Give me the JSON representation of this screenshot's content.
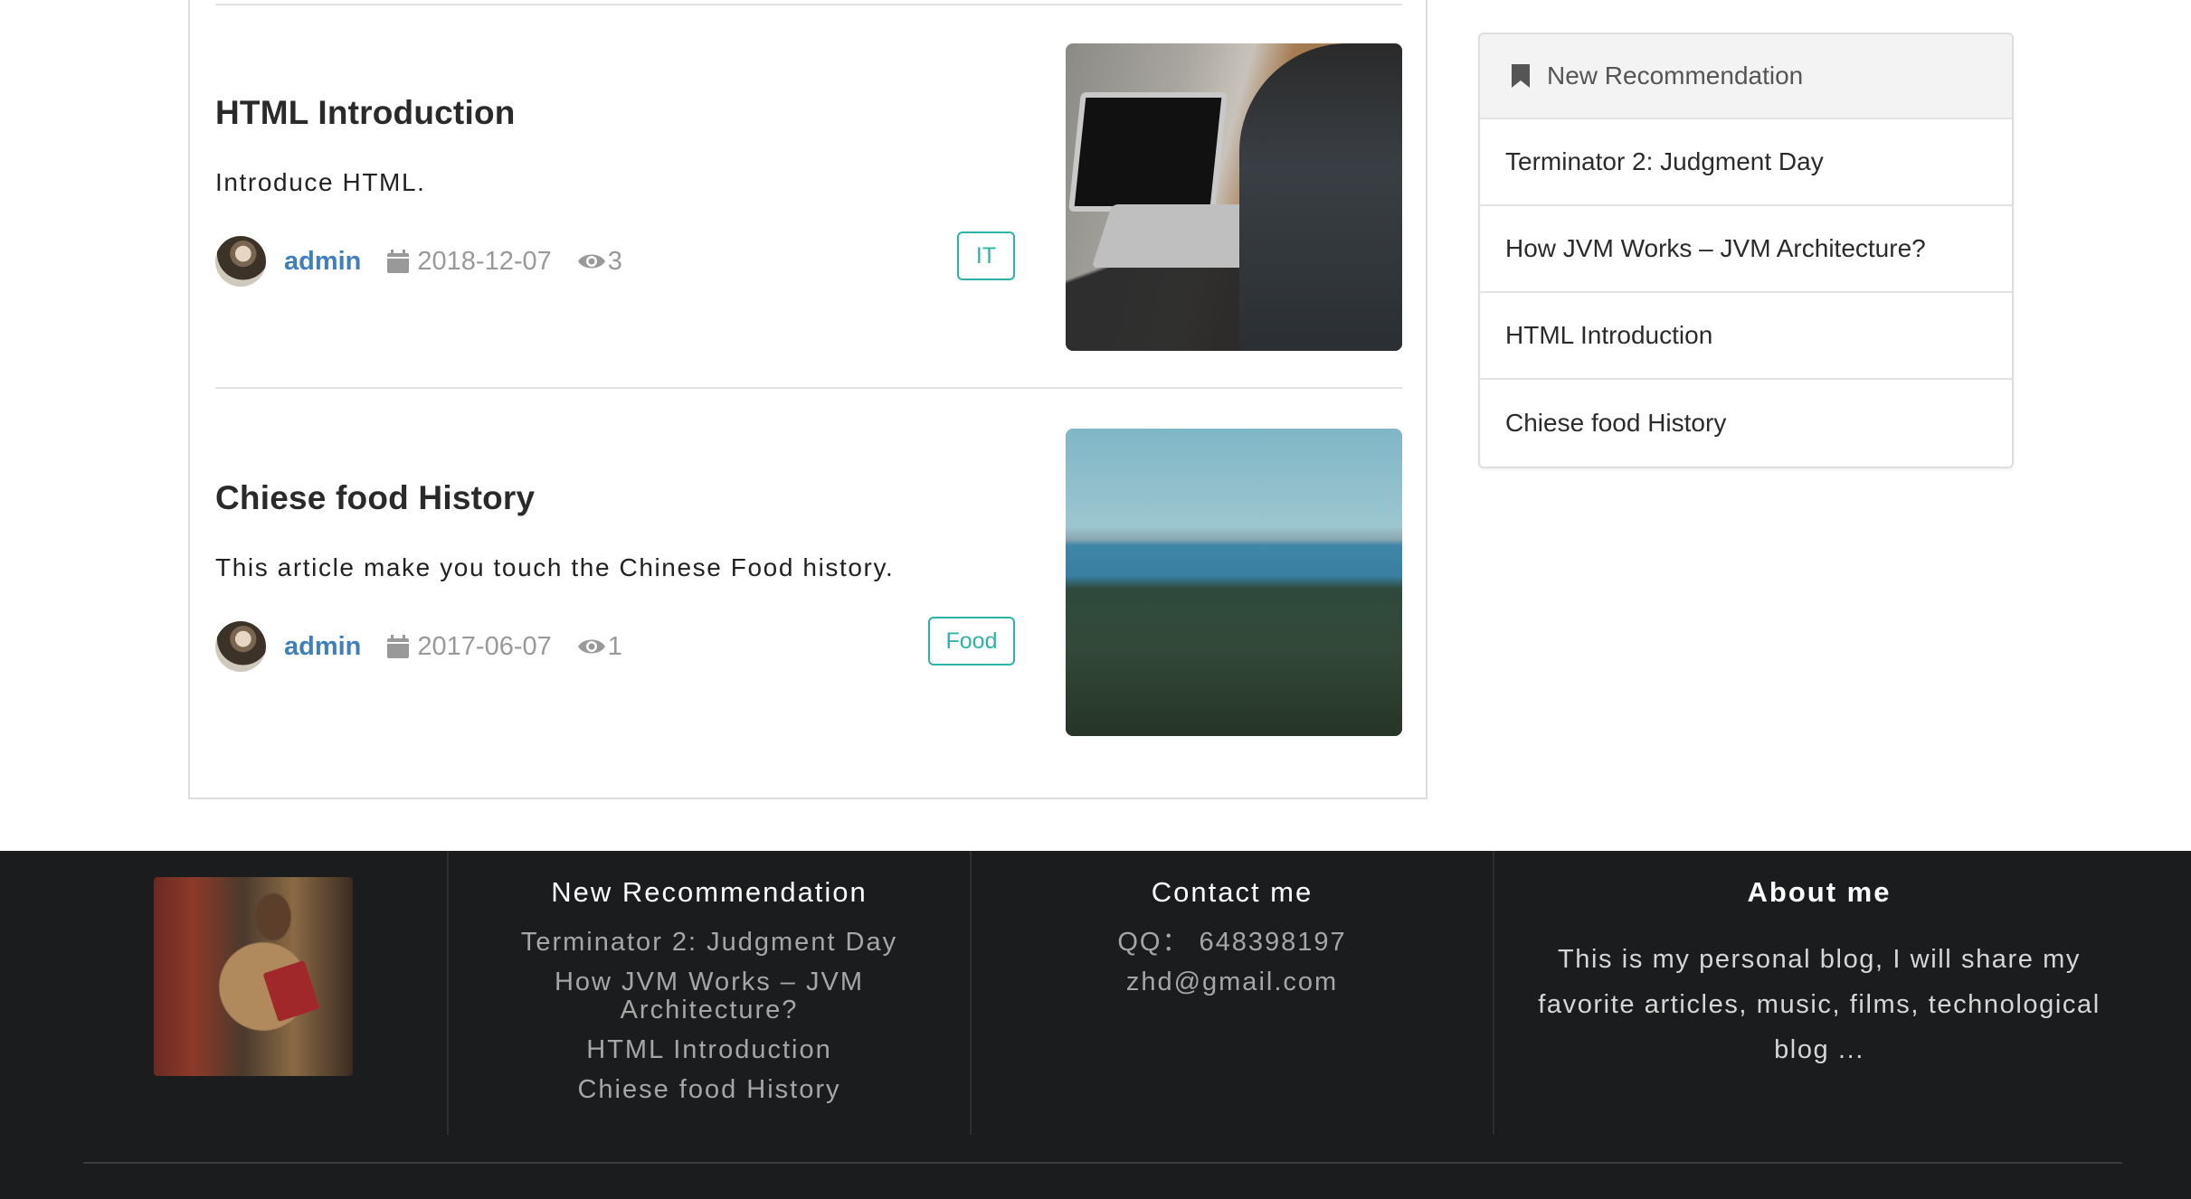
{
  "articles": [
    {
      "title": "HTML Introduction",
      "description": "Introduce HTML.",
      "author": "admin",
      "date": "2018-12-07",
      "views": "3",
      "tag": "IT",
      "image_icon": "laptop-photo"
    },
    {
      "title": "Chiese food History",
      "description": "This article make you touch the Chinese Food history.",
      "author": "admin",
      "date": "2017-06-07",
      "views": "1",
      "tag": "Food",
      "image_icon": "forest-lake-photo"
    }
  ],
  "sidebar": {
    "title": "New Recommendation",
    "icon": "bookmark-icon",
    "items": [
      "Terminator 2: Judgment Day",
      "How JVM Works – JVM Architecture?",
      "HTML Introduction",
      "Chiese food History"
    ]
  },
  "footer": {
    "recommend": {
      "title": "New Recommendation",
      "links": [
        "Terminator 2: Judgment Day",
        "How JVM Works – JVM Architecture?",
        "HTML Introduction",
        "Chiese food History"
      ]
    },
    "contact": {
      "title": "Contact me",
      "qq": "QQ： 648398197",
      "email": "zhd@gmail.com"
    },
    "about": {
      "title": "About me",
      "text": "This is my personal blog, I will share my favorite articles, music, films, technological blog ..."
    }
  },
  "colors": {
    "author_link": "#3f7fc0",
    "tag": "#2bb3a7",
    "footer_bg": "#1b1c1d",
    "meta_text": "#999999"
  }
}
